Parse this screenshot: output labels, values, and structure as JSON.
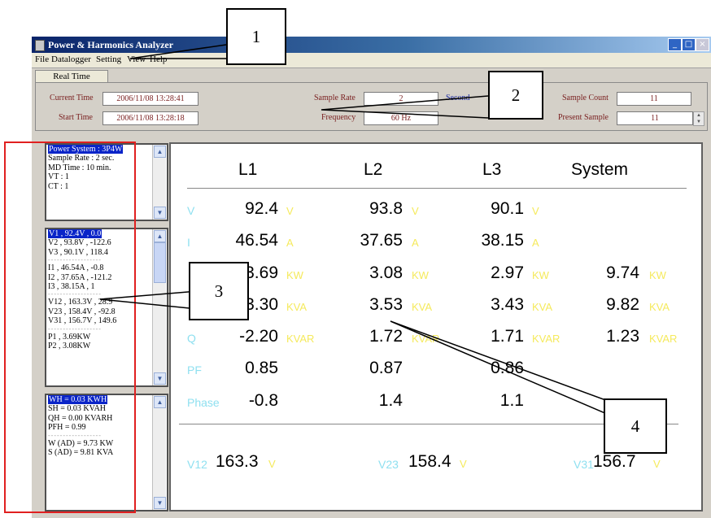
{
  "window": {
    "title": "Power & Harmonics Analyzer"
  },
  "menu": [
    "File",
    "Datalogger",
    "Setting",
    "View",
    "Help"
  ],
  "tab": "Real Time",
  "info": {
    "current_time_label": "Current Time",
    "current_time": "2006/11/08 13:28:41",
    "start_time_label": "Start Time",
    "start_time": "2006/11/08 13:28:18",
    "sample_rate_label": "Sample Rate",
    "sample_rate": "2",
    "sample_rate_unit": "Second",
    "frequency_label": "Frequency",
    "frequency": "60 Hz",
    "sample_count_label": "Sample Count",
    "sample_count": "11",
    "present_sample_label": "Present Sample",
    "present_sample": "11"
  },
  "box1": [
    "Power System : 3P4W",
    "Sample Rate : 2 sec.",
    "MD Time : 10 min.",
    "VT : 1",
    "CT : 1"
  ],
  "box2": [
    "V1 , 92.4V , 0.0",
    "V2 , 93.8V , -122.6",
    "V3 , 90.1V , 118.4",
    "I1 , 46.54A , -0.8",
    "I2 , 37.65A , -121.2",
    "I3 , 38.15A , 1",
    "V12 , 163.3V , 28.9",
    "V23 , 158.4V , -92.8",
    "V31 , 156.7V , 149.6",
    "P1 , 3.69KW",
    "P2 , 3.08KW"
  ],
  "box3": [
    "WH = 0.03 KWH",
    "SH = 0.03 KVAH",
    "QH = 0.00 KVARH",
    "PFH = 0.99",
    "W (AD) = 9.73 KW",
    "S (AD) = 9.81 KVA"
  ],
  "headers": [
    "L1",
    "L2",
    "L3",
    "System"
  ],
  "rows": [
    {
      "label": "V",
      "values": [
        "92.4",
        "93.8",
        "90.1",
        ""
      ],
      "units": [
        "V",
        "V",
        "V",
        ""
      ]
    },
    {
      "label": "I",
      "values": [
        "46.54",
        "37.65",
        "38.15",
        ""
      ],
      "units": [
        "A",
        "A",
        "A",
        ""
      ]
    },
    {
      "label": "",
      "values": [
        "3.69",
        "3.08",
        "2.97",
        "9.74"
      ],
      "units": [
        "KW",
        "KW",
        "KW",
        "KW"
      ]
    },
    {
      "label": "",
      "values": [
        "3.30",
        "3.53",
        "3.43",
        "9.82"
      ],
      "units": [
        "KVA",
        "KVA",
        "KVA",
        "KVA"
      ]
    },
    {
      "label": "Q",
      "values": [
        "-2.20",
        "1.72",
        "1.71",
        "1.23"
      ],
      "units": [
        "KVAR",
        "KVAR",
        "KVAR",
        "KVAR"
      ]
    },
    {
      "label": "PF",
      "values": [
        "0.85",
        "0.87",
        "0.86",
        ""
      ],
      "units": [
        "",
        "",
        "",
        ""
      ]
    },
    {
      "label": "Phase",
      "values": [
        "-0.8",
        "1.4",
        "1.1",
        ""
      ],
      "units": [
        "",
        "",
        "",
        ""
      ]
    }
  ],
  "line_voltages": [
    {
      "label": "V12",
      "value": "163.3",
      "unit": "V"
    },
    {
      "label": "V23",
      "value": "158.4",
      "unit": "V"
    },
    {
      "label": "V31",
      "value": "156.7",
      "unit": "V"
    }
  ],
  "callouts": [
    "1",
    "2",
    "3",
    "4"
  ],
  "colors": {
    "label": "#8fe0f0",
    "unit": "#f5ea5c",
    "highlight": "#0a24c8",
    "marker": "#e02020"
  }
}
